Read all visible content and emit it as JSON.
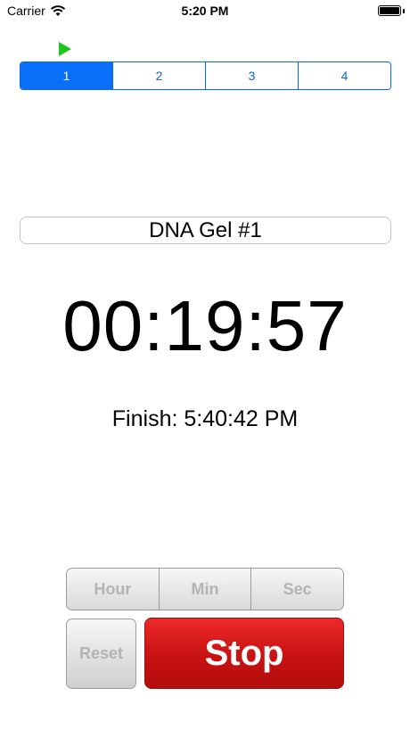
{
  "status_bar": {
    "carrier": "Carrier",
    "time": "5:20 PM",
    "wifi_icon": "wifi-icon",
    "battery_icon": "battery-icon"
  },
  "indicator": {
    "icon": "play-icon",
    "color": "#1fc41f"
  },
  "timer_tabs": [
    {
      "label": "1",
      "selected": true
    },
    {
      "label": "2",
      "selected": false
    },
    {
      "label": "3",
      "selected": false
    },
    {
      "label": "4",
      "selected": false
    }
  ],
  "timer": {
    "name": "DNA Gel #1",
    "countdown": "00:19:57",
    "finish": "Finish: 5:40:42 PM"
  },
  "controls": {
    "hour_label": "Hour",
    "min_label": "Min",
    "sec_label": "Sec",
    "reset_label": "Reset",
    "stop_label": "Stop"
  },
  "colors": {
    "accent": "#0a6ff9",
    "stop": "#d81a1a",
    "disabled_text": "#b3b3b3"
  }
}
